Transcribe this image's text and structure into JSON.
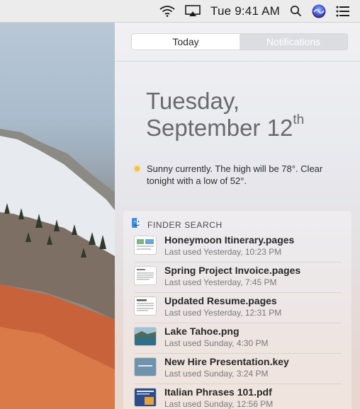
{
  "menubar": {
    "clock": "Tue 9:41 AM",
    "icons": [
      "wifi-icon",
      "airplay-icon",
      "search-icon",
      "siri-icon",
      "notification-center-icon"
    ]
  },
  "panel": {
    "tabs": [
      {
        "label": "Today",
        "active": true
      },
      {
        "label": "Notifications",
        "active": false
      }
    ],
    "date": {
      "weekday": "Tuesday,",
      "month_day": "September 12",
      "ordinal_suffix": "th"
    },
    "weather": {
      "text": "Sunny currently. The high will be 78°.  Clear tonight with a low of 52°.",
      "dot_color": "#f6c22d"
    },
    "finder_search": {
      "header": "FINDER SEARCH",
      "files": [
        {
          "name": "Honeymoon Itinerary.pages",
          "meta": "Last used Yesterday, 10:23 PM",
          "thumb": "pages-itinerary-thumb"
        },
        {
          "name": "Spring Project Invoice.pages",
          "meta": "Last used Yesterday, 7:45 PM",
          "thumb": "pages-invoice-thumb"
        },
        {
          "name": "Updated Resume.pages",
          "meta": "Last used Yesterday, 12:31 PM",
          "thumb": "pages-resume-thumb"
        },
        {
          "name": "Lake Tahoe.png",
          "meta": "Last used Sunday, 4:30 PM",
          "thumb": "landscape-photo-thumb"
        },
        {
          "name": "New Hire Presentation.key",
          "meta": "Last used Sunday, 3:24 PM",
          "thumb": "keynote-thumb"
        },
        {
          "name": "Italian Phrases 101.pdf",
          "meta": "Last used Sunday, 12:56 PM",
          "thumb": "pdf-thumb"
        }
      ]
    }
  }
}
